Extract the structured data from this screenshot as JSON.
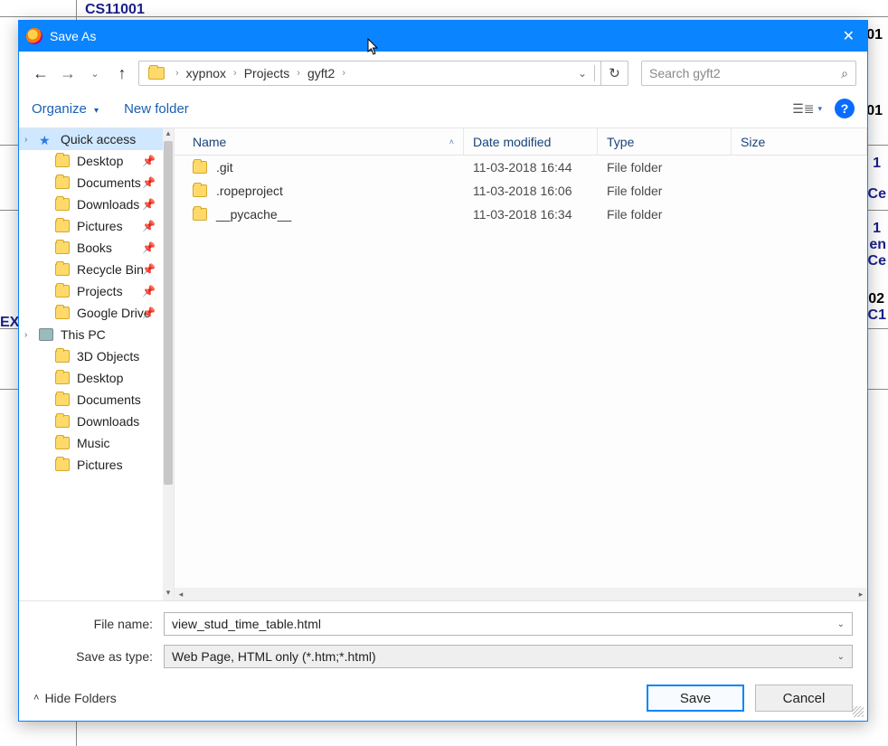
{
  "background": {
    "top_text": "CS11001",
    "right_1": "1",
    "right_2": "Ce",
    "right_3": "1",
    "right_4": "en",
    "right_5": "Ce",
    "left_text": "EX",
    "extra_01_1": "01",
    "extra_01_2": "01",
    "extra_02": "02",
    "extra_c1": "C1"
  },
  "dialog": {
    "title": "Save As",
    "breadcrumbs": [
      "xypnox",
      "Projects",
      "gyft2"
    ],
    "search_placeholder": "Search gyft2",
    "toolbar": {
      "organize": "Organize",
      "new_folder": "New folder"
    },
    "sidebar": {
      "sections": [
        {
          "label": "Quick access",
          "items": [
            {
              "label": "Desktop",
              "pinned": true
            },
            {
              "label": "Documents",
              "pinned": true
            },
            {
              "label": "Downloads",
              "pinned": true
            },
            {
              "label": "Pictures",
              "pinned": true
            },
            {
              "label": "Books",
              "pinned": true
            },
            {
              "label": "Recycle Bin",
              "pinned": true
            },
            {
              "label": "Projects",
              "pinned": true
            },
            {
              "label": "Google Drive",
              "pinned": true
            }
          ]
        },
        {
          "label": "This PC",
          "items": [
            {
              "label": "3D Objects"
            },
            {
              "label": "Desktop"
            },
            {
              "label": "Documents"
            },
            {
              "label": "Downloads"
            },
            {
              "label": "Music"
            },
            {
              "label": "Pictures"
            }
          ]
        }
      ]
    },
    "columns": {
      "name": "Name",
      "date": "Date modified",
      "type": "Type",
      "size": "Size"
    },
    "rows": [
      {
        "name": ".git",
        "date": "11-03-2018 16:44",
        "type": "File folder",
        "size": ""
      },
      {
        "name": ".ropeproject",
        "date": "11-03-2018 16:06",
        "type": "File folder",
        "size": ""
      },
      {
        "name": "__pycache__",
        "date": "11-03-2018 16:34",
        "type": "File folder",
        "size": ""
      }
    ],
    "filename_label": "File name:",
    "filename_value": "view_stud_time_table.html",
    "savetype_label": "Save as type:",
    "savetype_value": "Web Page, HTML only (*.htm;*.html)",
    "hide_folders": "Hide Folders",
    "save": "Save",
    "cancel": "Cancel"
  }
}
